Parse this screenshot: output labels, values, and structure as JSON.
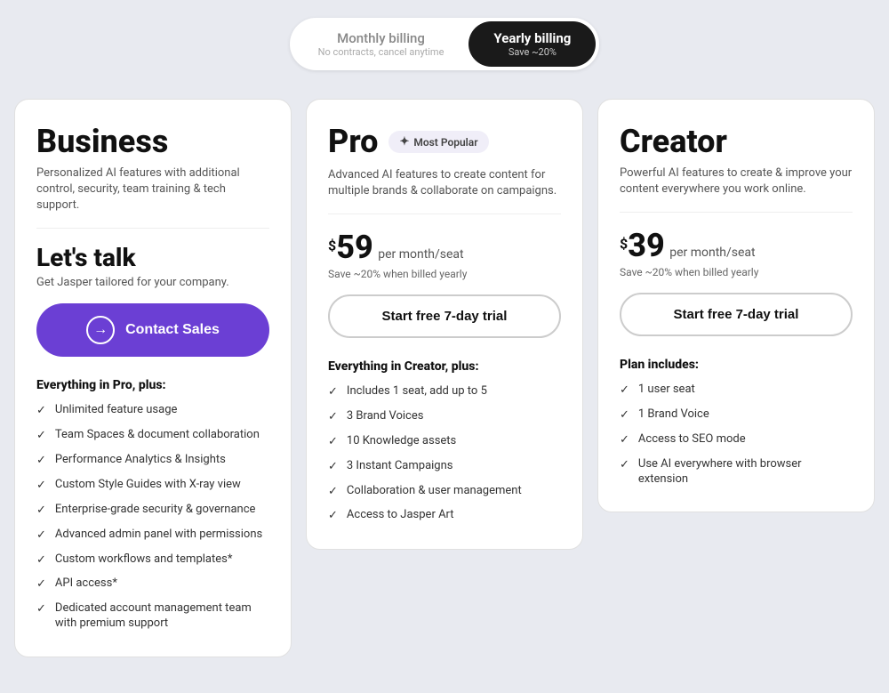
{
  "billing_toggle": {
    "monthly": {
      "label": "Monthly billing",
      "sublabel": "No contracts, cancel anytime"
    },
    "yearly": {
      "label": "Yearly billing",
      "sublabel": "Save ~20%"
    }
  },
  "cards": {
    "business": {
      "title": "Business",
      "description": "Personalized AI features with additional control, security, team training & tech support.",
      "price_heading": "Let's talk",
      "price_subtext": "Get Jasper tailored for your company.",
      "cta_label": "Contact Sales",
      "features_heading": "Everything in Pro, plus:",
      "features": [
        "Unlimited feature usage",
        "Team Spaces & document collaboration",
        "Performance Analytics & Insights",
        "Custom Style Guides with X-ray view",
        "Enterprise-grade security & governance",
        "Advanced admin panel with permissions",
        "Custom workflows and templates*",
        "API access*",
        "Dedicated account management team with premium support"
      ]
    },
    "pro": {
      "title": "Pro",
      "badge": "Most Popular",
      "description": "Advanced AI features to create content for multiple brands & collaborate on campaigns.",
      "currency": "$",
      "amount": "59",
      "period": "per month/seat",
      "savings": "Save ~20% when billed yearly",
      "cta_label": "Start free 7-day trial",
      "features_heading": "Everything in Creator, plus:",
      "features": [
        "Includes 1 seat, add up to 5",
        "3 Brand Voices",
        "10 Knowledge assets",
        "3 Instant Campaigns",
        "Collaboration & user management",
        "Access to Jasper Art"
      ]
    },
    "creator": {
      "title": "Creator",
      "description": "Powerful AI features to create & improve your content everywhere you work online.",
      "currency": "$",
      "amount": "39",
      "period": "per month/seat",
      "savings": "Save ~20% when billed yearly",
      "cta_label": "Start free 7-day trial",
      "features_heading": "Plan includes:",
      "features": [
        "1 user seat",
        "1 Brand Voice",
        "Access to SEO mode",
        "Use AI everywhere with browser extension"
      ]
    }
  }
}
